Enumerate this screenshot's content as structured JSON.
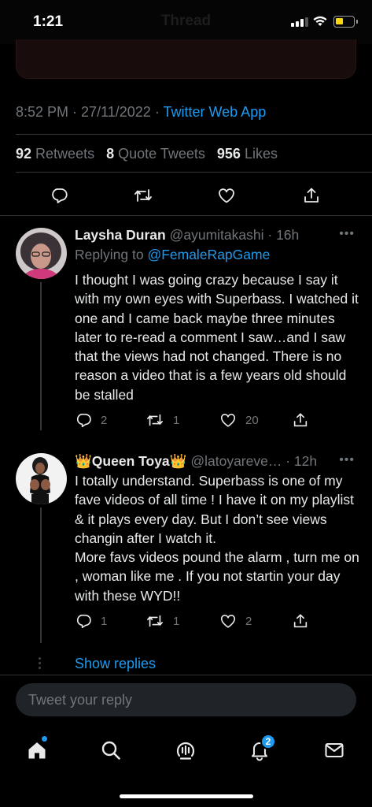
{
  "status_bar": {
    "time": "1:21",
    "ghost_title": "Thread"
  },
  "tweet": {
    "time": "8:52 PM",
    "date": "27/11/2022",
    "source": "Twitter Web App",
    "retweets_count": "92",
    "retweets_label": "Retweets",
    "quote_count": "8",
    "quote_label": "Quote Tweets",
    "likes_count": "956",
    "likes_label": "Likes"
  },
  "replies": [
    {
      "name": "Laysha Duran",
      "handle": "@ayumitakashi",
      "age": "16h",
      "replying_to_prefix": "Replying to",
      "replying_to": "@FemaleRapGame",
      "body": "I thought I was going crazy because I say it with my own eyes with Superbass. I watched it one and I came back maybe three minutes later to re-read a comment I saw…and I saw that the views had not changed. There is no reason a video that is a few years old should be stalled",
      "reply_count": "2",
      "retweet_count": "1",
      "like_count": "20"
    },
    {
      "name": "Queen Toya",
      "name_emoji": "👑",
      "handle": "@latoyareve…",
      "age": "12h",
      "body": "I totally understand. Superbass is one of my fave videos of all time ! I have it on my playlist & it plays every day. But I don’t see views changin after I watch it.\nMore favs videos pound the alarm , turn me on , woman like me . If you not startin your day with these WYD!!",
      "reply_count": "1",
      "retweet_count": "1",
      "like_count": "2"
    }
  ],
  "show_replies": "Show replies",
  "composer": {
    "placeholder": "Tweet your reply"
  },
  "tabbar": {
    "notifications_badge": "2"
  },
  "colors": {
    "accent": "#1d9bf0",
    "background": "#000000",
    "muted": "#71767b",
    "battery": "#ffd60a"
  },
  "icons": [
    "reply-icon",
    "retweet-icon",
    "like-icon",
    "share-icon",
    "more-icon",
    "home-icon",
    "search-icon",
    "spaces-icon",
    "notifications-icon",
    "messages-icon"
  ]
}
